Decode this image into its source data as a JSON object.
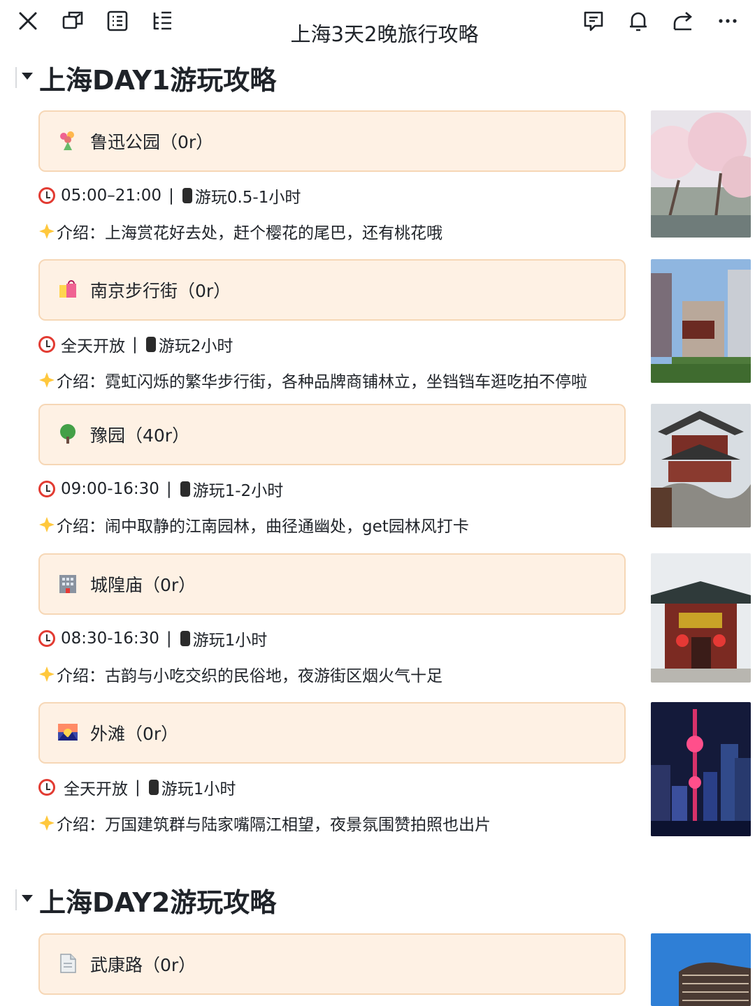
{
  "window": {
    "title": "上海3天2晚旅行攻略"
  },
  "toolbar": {
    "left_icons": [
      "close-icon",
      "window-icon",
      "outline-icon",
      "list-tree-icon"
    ],
    "right_icons": [
      "comment-icon",
      "bell-icon",
      "share-icon",
      "more-icon"
    ]
  },
  "sections": [
    {
      "title": "上海DAY1游玩攻略",
      "spots": [
        {
          "icon": "bouquet-icon",
          "name": "鲁迅公园（0r）",
          "hours": "05:00–21:00",
          "duration": "游玩0.5-1小时",
          "intro": "介绍：上海赏花好去处，赶个樱花的尾巴，还有桃花哦",
          "photo": "cherry-blossom-park-photo"
        },
        {
          "icon": "shopping-bags-icon",
          "name": "南京步行街（0r）",
          "hours": "全天开放",
          "duration": "游玩2小时",
          "intro": "介绍：霓虹闪烁的繁华步行街，各种品牌商铺林立，坐铛铛车逛吃拍不停啦",
          "photo": "nanjing-road-photo"
        },
        {
          "icon": "tree-icon",
          "name": "豫园（40r）",
          "hours": "09:00-16:30",
          "duration": "游玩1-2小时",
          "intro": "介绍：闹中取静的江南园林，曲径通幽处，get园林风打卡",
          "photo": "yu-garden-photo"
        },
        {
          "icon": "hotel-icon",
          "name": "城隍庙（0r）",
          "hours": "08:30-16:30",
          "duration": "游玩1小时",
          "intro": "介绍：古韵与小吃交织的民俗地，夜游街区烟火气十足",
          "photo": "city-god-temple-photo"
        },
        {
          "icon": "sunset-icon",
          "name": "外滩（0r）",
          "hours": "全天开放",
          "duration": "游玩1小时",
          "intro": "介绍：万国建筑群与陆家嘴隔江相望，夜景氛围赞拍照也出片",
          "photo": "bund-night-photo"
        }
      ]
    },
    {
      "title": "上海DAY2游玩攻略",
      "spots": [
        {
          "icon": "page-icon",
          "name": "武康路（0r）",
          "photo": "wukang-mansion-photo"
        }
      ]
    }
  ],
  "colors": {
    "card_bg": "#fef1e4",
    "card_border": "#f6d7b6",
    "clock_red": "#e23b32",
    "text": "#1f2329"
  }
}
